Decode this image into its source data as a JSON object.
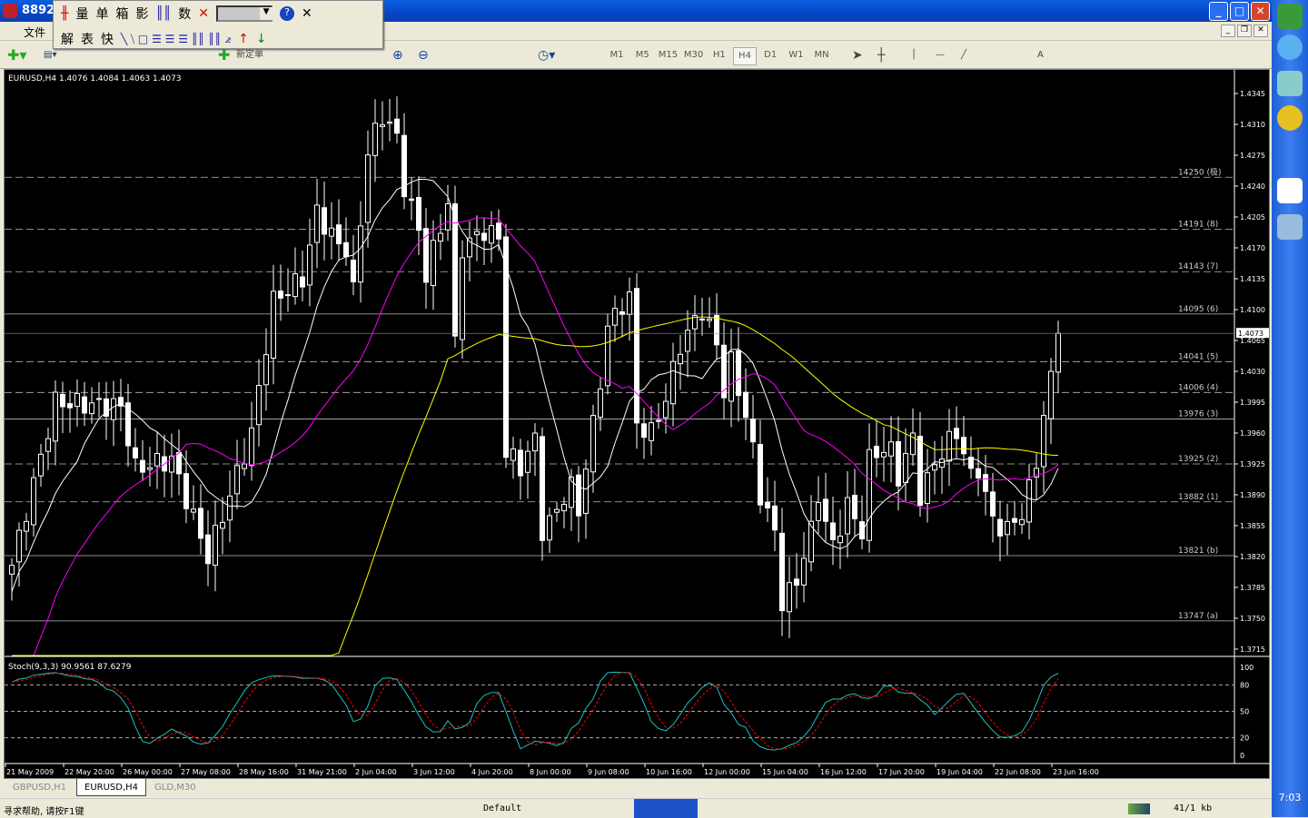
{
  "window": {
    "title": "8892",
    "menu_file": "文件"
  },
  "floating_toolbar": {
    "row1": [
      "量",
      "单",
      "箱",
      "影",
      "数"
    ],
    "row2": [
      "解",
      "表",
      "快"
    ],
    "help": "?",
    "close": "✕"
  },
  "toolbar": {
    "new_order_label": "新定单",
    "timeframes": [
      "M1",
      "M5",
      "M15",
      "M30",
      "H1",
      "H4",
      "D1",
      "W1",
      "MN"
    ],
    "active_timeframe": "H4",
    "text_tool": "A"
  },
  "chart": {
    "header": "EURUSD,H4  1.4076 1.4084 1.4063 1.4073",
    "current_price": "1.4073"
  },
  "chart_data": {
    "type": "candlestick",
    "symbol": "EURUSD",
    "timeframe": "H4",
    "ylim": [
      1.37,
      1.4365
    ],
    "price_ticks": [
      "1.4345",
      "1.4310",
      "1.4275",
      "1.4240",
      "1.4205",
      "1.4170",
      "1.4135",
      "1.4100",
      "1.4065",
      "1.4030",
      "1.3995",
      "1.3960",
      "1.3925",
      "1.3890",
      "1.3855",
      "1.3820",
      "1.3785",
      "1.3750",
      "1.3715"
    ],
    "time_labels": [
      "21 May 2009",
      "22 May 20:00",
      "26 May 00:00",
      "27 May 08:00",
      "28 May 16:00",
      "31 May 21:00",
      "2 Jun 04:00",
      "3 Jun 12:00",
      "4 Jun 20:00",
      "8 Jun 00:00",
      "9 Jun 08:00",
      "10 Jun 16:00",
      "12 Jun 00:00",
      "15 Jun 04:00",
      "16 Jun 12:00",
      "17 Jun 20:00",
      "19 Jun 04:00",
      "22 Jun 08:00",
      "23 Jun 16:00"
    ],
    "bar_count": 145,
    "close_keypoints": [
      [
        0,
        1.381
      ],
      [
        6,
        1.3995
      ],
      [
        15,
        1.399
      ],
      [
        17,
        1.392
      ],
      [
        22,
        1.393
      ],
      [
        27,
        1.382
      ],
      [
        30,
        1.389
      ],
      [
        33,
        1.396
      ],
      [
        36,
        1.411
      ],
      [
        40,
        1.4135
      ],
      [
        42,
        1.421
      ],
      [
        46,
        1.416
      ],
      [
        47,
        1.412
      ],
      [
        49,
        1.428
      ],
      [
        51,
        1.432
      ],
      [
        53,
        1.43
      ],
      [
        54,
        1.424
      ],
      [
        56,
        1.419
      ],
      [
        57,
        1.414
      ],
      [
        60,
        1.422
      ],
      [
        61,
        1.407
      ],
      [
        62,
        1.417
      ],
      [
        65,
        1.419
      ],
      [
        67,
        1.418
      ],
      [
        68,
        1.394
      ],
      [
        70,
        1.392
      ],
      [
        72,
        1.396
      ],
      [
        73,
        1.385
      ],
      [
        75,
        1.387
      ],
      [
        77,
        1.391
      ],
      [
        78,
        1.387
      ],
      [
        80,
        1.398
      ],
      [
        81,
        1.401
      ],
      [
        82,
        1.408
      ],
      [
        85,
        1.412
      ],
      [
        86,
        1.397
      ],
      [
        88,
        1.396
      ],
      [
        90,
        1.4
      ],
      [
        92,
        1.406
      ],
      [
        95,
        1.41
      ],
      [
        97,
        1.406
      ],
      [
        98,
        1.4
      ],
      [
        99,
        1.404
      ],
      [
        102,
        1.395
      ],
      [
        103,
        1.389
      ],
      [
        105,
        1.385
      ],
      [
        106,
        1.377
      ],
      [
        108,
        1.379
      ],
      [
        110,
        1.386
      ],
      [
        111,
        1.389
      ],
      [
        113,
        1.383
      ],
      [
        115,
        1.388
      ],
      [
        117,
        1.384
      ],
      [
        118,
        1.393
      ],
      [
        121,
        1.395
      ],
      [
        122,
        1.391
      ],
      [
        124,
        1.396
      ],
      [
        125,
        1.389
      ],
      [
        128,
        1.394
      ],
      [
        130,
        1.396
      ],
      [
        132,
        1.392
      ],
      [
        133,
        1.392
      ],
      [
        135,
        1.386
      ],
      [
        137,
        1.385
      ],
      [
        139,
        1.387
      ],
      [
        141,
        1.392
      ],
      [
        142,
        1.398
      ],
      [
        143,
        1.403
      ],
      [
        144,
        1.4073
      ]
    ],
    "moving_averages": [
      {
        "period": 10,
        "color": "#ffffff"
      },
      {
        "period": 24,
        "color": "#ff00ff"
      },
      {
        "period": 60,
        "color": "#ffff00"
      }
    ],
    "levels": [
      {
        "price": 1.425,
        "label": "14250 (极)",
        "style": "dashed"
      },
      {
        "price": 1.4191,
        "label": "14191 (8)",
        "style": "dashed"
      },
      {
        "price": 1.4143,
        "label": "14143 (7)",
        "style": "dashed"
      },
      {
        "price": 1.4095,
        "label": "14095 (6)",
        "style": "solid"
      },
      {
        "price": 1.4041,
        "label": "14041 (5)",
        "style": "dashed"
      },
      {
        "price": 1.4006,
        "label": "14006 (4)",
        "style": "dashed"
      },
      {
        "price": 1.3976,
        "label": "13976 (3)",
        "style": "solid"
      },
      {
        "price": 1.3925,
        "label": "13925 (2)",
        "style": "dashed"
      },
      {
        "price": 1.3882,
        "label": "13882 (1)",
        "style": "dashed"
      },
      {
        "price": 1.3821,
        "label": "13821 (b)",
        "style": "solid"
      },
      {
        "price": 1.3747,
        "label": "13747 (a)",
        "style": "solid"
      }
    ],
    "stochastic": {
      "label": "Stoch(9,3,3) 90.9561 87.6279",
      "params": [
        9,
        3,
        3
      ],
      "main": 90.9561,
      "signal": 87.6279,
      "ticks": [
        "100",
        "80",
        "50",
        "20",
        "0"
      ],
      "levels": [
        80,
        50,
        20
      ]
    }
  },
  "tabs": [
    {
      "label": "GBPUSD,H1"
    },
    {
      "label": "EURUSD,H4",
      "active": true
    },
    {
      "label": "GLD,M30"
    }
  ],
  "status": {
    "help": "寻求帮助, 请按F1键",
    "profile": "Default",
    "traffic": "41/1 kb"
  },
  "taskbar": {
    "clock": "7:03"
  }
}
